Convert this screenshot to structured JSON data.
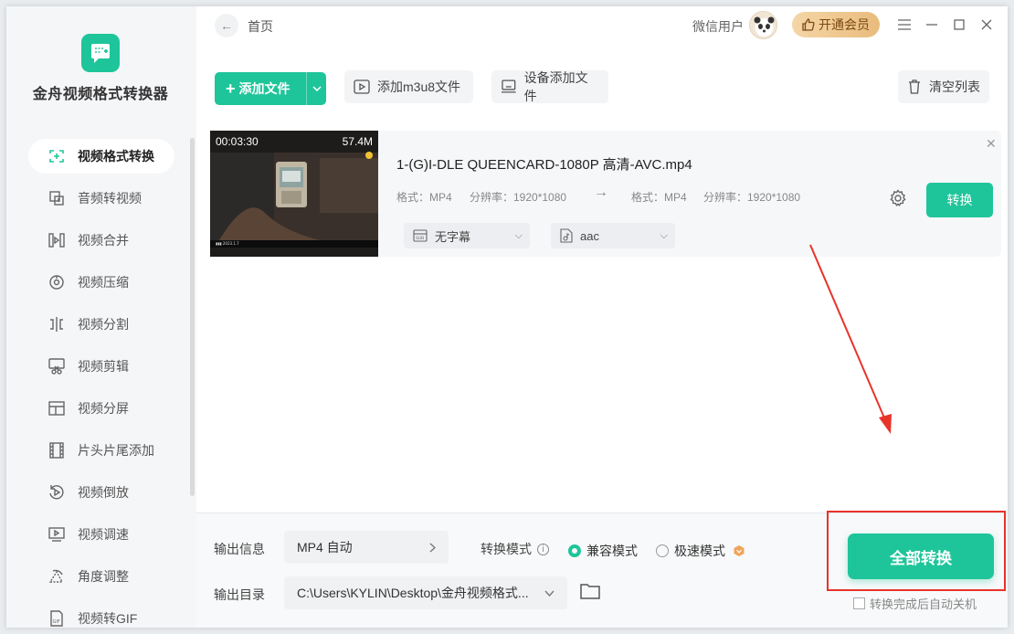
{
  "app": {
    "name": "金舟视频格式转换器"
  },
  "sidebar": {
    "items": [
      {
        "label": "视频格式转换",
        "icon": "format-convert-icon",
        "active": true
      },
      {
        "label": "音频转视频",
        "icon": "audio-to-video-icon"
      },
      {
        "label": "视频合并",
        "icon": "video-merge-icon"
      },
      {
        "label": "视频压缩",
        "icon": "video-compress-icon"
      },
      {
        "label": "视频分割",
        "icon": "video-split-icon"
      },
      {
        "label": "视频剪辑",
        "icon": "video-edit-icon"
      },
      {
        "label": "视频分屏",
        "icon": "split-screen-icon"
      },
      {
        "label": "片头片尾添加",
        "icon": "film-icon"
      },
      {
        "label": "视频倒放",
        "icon": "reverse-icon"
      },
      {
        "label": "视频调速",
        "icon": "speed-icon"
      },
      {
        "label": "角度调整",
        "icon": "rotate-icon"
      },
      {
        "label": "视频转GIF",
        "icon": "gif-icon"
      }
    ]
  },
  "header": {
    "breadcrumb": "首页",
    "user": "微信用户",
    "vip": "开通会员"
  },
  "toolbar": {
    "add_file": "添加文件",
    "add_m3u8": "添加m3u8文件",
    "device_add": "设备添加文件",
    "clear_list": "清空列表"
  },
  "file": {
    "duration": "00:03:30",
    "size": "57.4M",
    "name": "1-(G)I-DLE QUEENCARD-1080P 高清-AVC.mp4",
    "src_format": "格式：MP4",
    "src_resolution": "分辨率：1920*1080",
    "dst_format": "格式：MP4",
    "dst_resolution": "分辨率：1920*1080",
    "convert": "转换",
    "subtitle": "无字幕",
    "audio": "aac"
  },
  "bottom": {
    "output_info_label": "输出信息",
    "output_info_value": "MP4 自动",
    "mode_label": "转换模式",
    "mode_compat": "兼容模式",
    "mode_fast": "极速模式",
    "output_dir_label": "输出目录",
    "output_dir_value": "C:\\Users\\KYLIN\\Desktop\\金舟视频格式...",
    "convert_all": "全部转换",
    "auto_shutdown": "转换完成后自动关机"
  },
  "colors": {
    "accent": "#1fc59a",
    "highlight": "#e8332b",
    "vip": "#e9bb7c"
  }
}
